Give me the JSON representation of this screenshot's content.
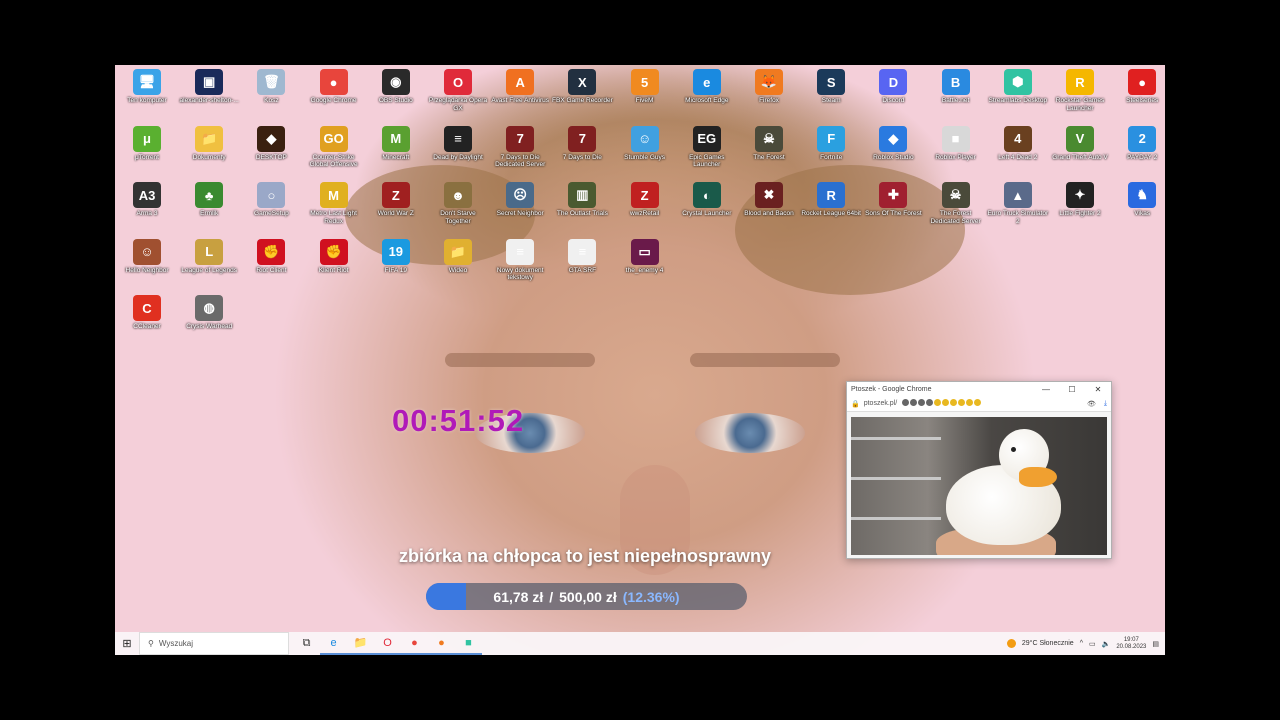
{
  "desktop": {
    "icons": [
      {
        "label": "Ten komputer",
        "glyph": "🖥",
        "color": "#3aa3e8"
      },
      {
        "label": "alexander-shelton-...",
        "glyph": "▣",
        "color": "#1a2a5a"
      },
      {
        "label": "Kosz",
        "glyph": "🗑",
        "color": "#9fb8d0"
      },
      {
        "label": "Google Chrome",
        "glyph": "●",
        "color": "#e8453c"
      },
      {
        "label": "OBS Studio",
        "glyph": "◉",
        "color": "#2a2a2a"
      },
      {
        "label": "Przeglądarka Opera GX",
        "glyph": "O",
        "color": "#e02a3a"
      },
      {
        "label": "Avast Free Antivirus",
        "glyph": "A",
        "color": "#f07020"
      },
      {
        "label": "FBX Game Recorder",
        "glyph": "X",
        "color": "#223040"
      },
      {
        "label": "FiveM",
        "glyph": "5",
        "color": "#f08a20"
      },
      {
        "label": "Microsoft Edge",
        "glyph": "e",
        "color": "#1a8ae0"
      },
      {
        "label": "Firefox",
        "glyph": "🦊",
        "color": "#f07a20"
      },
      {
        "label": "Steam",
        "glyph": "S",
        "color": "#1b3a5a"
      },
      {
        "label": "Discord",
        "glyph": "D",
        "color": "#5865f2"
      },
      {
        "label": "Battle.net",
        "glyph": "B",
        "color": "#2a8ae0"
      },
      {
        "label": "Streamlabs Desktop",
        "glyph": "⬢",
        "color": "#31c3a2"
      },
      {
        "label": "Rockstar Games Launcher",
        "glyph": "R",
        "color": "#f5b700"
      },
      {
        "label": "Steelseries",
        "glyph": "●",
        "color": "#e02020"
      },
      {
        "label": "μTorrent",
        "glyph": "μ",
        "color": "#5ab030"
      },
      {
        "label": "Dokumenty",
        "glyph": "📁",
        "color": "#f0c040"
      },
      {
        "label": "DESKTOP",
        "glyph": "◆",
        "color": "#3a2010"
      },
      {
        "label": "Counter-Strike Global Offensive",
        "glyph": "GO",
        "color": "#e0a020"
      },
      {
        "label": "Minecraft",
        "glyph": "M",
        "color": "#5aa030"
      },
      {
        "label": "Dead by Daylight",
        "glyph": "≡",
        "color": "#222"
      },
      {
        "label": "7 Days to Die Dedicated Server",
        "glyph": "7",
        "color": "#802020"
      },
      {
        "label": "7 Days to Die",
        "glyph": "7",
        "color": "#802020"
      },
      {
        "label": "Stumble Guys",
        "glyph": "☺",
        "color": "#40a0e0"
      },
      {
        "label": "Epic Games Launcher",
        "glyph": "EG",
        "color": "#222"
      },
      {
        "label": "The Forest",
        "glyph": "☠",
        "color": "#4a4a3a"
      },
      {
        "label": "Fortnite",
        "glyph": "F",
        "color": "#2aa0e0"
      },
      {
        "label": "Roblox Studio",
        "glyph": "◆",
        "color": "#2a7ae0"
      },
      {
        "label": "Roblox Player",
        "glyph": "■",
        "color": "#d8d8d8"
      },
      {
        "label": "Left 4 Dead 2",
        "glyph": "4",
        "color": "#6a4020"
      },
      {
        "label": "Grand Theft Auto V",
        "glyph": "V",
        "color": "#4a8a30"
      },
      {
        "label": "PAYDAY 2",
        "glyph": "2",
        "color": "#2a90e0"
      },
      {
        "label": "Arma 3",
        "glyph": "A3",
        "color": "#333"
      },
      {
        "label": "Ermlik",
        "glyph": "♣",
        "color": "#3a8a30"
      },
      {
        "label": "GameSetup",
        "glyph": "○",
        "color": "#9aa8c8"
      },
      {
        "label": "Metro Last Light Redux",
        "glyph": "M",
        "color": "#e0b020"
      },
      {
        "label": "World War Z",
        "glyph": "Z",
        "color": "#a02020"
      },
      {
        "label": "Don't Starve Together",
        "glyph": "☻",
        "color": "#8a7040"
      },
      {
        "label": "Secret Neighbor",
        "glyph": "☹",
        "color": "#4a6a8a"
      },
      {
        "label": "The Outlast Trials",
        "glyph": "▥",
        "color": "#4a5a30"
      },
      {
        "label": "wwzRetail",
        "glyph": "Z",
        "color": "#c02020"
      },
      {
        "label": "Crystal Launcher",
        "glyph": "◐",
        "color": "#1a5a4a"
      },
      {
        "label": "Blood and Bacon",
        "glyph": "✖",
        "color": "#6a2020"
      },
      {
        "label": "Rocket League 64bit",
        "glyph": "R",
        "color": "#2a70d0"
      },
      {
        "label": "Sons Of The Forest",
        "glyph": "✚",
        "color": "#a02030"
      },
      {
        "label": "The Forest Dedicated Server",
        "glyph": "☠",
        "color": "#4a4a3a"
      },
      {
        "label": "Euro Truck Simulator 2",
        "glyph": "▲",
        "color": "#5a6a8a"
      },
      {
        "label": "Little Fighter 2",
        "glyph": "✦",
        "color": "#222"
      },
      {
        "label": "Vikas",
        "glyph": "♞",
        "color": "#2a6ae0"
      },
      {
        "label": "Hello Neighbor",
        "glyph": "☺",
        "color": "#a05030"
      },
      {
        "label": "League of Legends",
        "glyph": "L",
        "color": "#c8a040"
      },
      {
        "label": "Riot Client",
        "glyph": "✊",
        "color": "#d01020"
      },
      {
        "label": "Klient Riot",
        "glyph": "✊",
        "color": "#d01020"
      },
      {
        "label": "FIFA 19",
        "glyph": "19",
        "color": "#1a9ae0"
      },
      {
        "label": "Wideo",
        "glyph": "📁",
        "color": "#e0b030"
      },
      {
        "label": "Nowy dokument tekstowy",
        "glyph": "≡",
        "color": "#f0f0f0"
      },
      {
        "label": "GTA SRF",
        "glyph": "≡",
        "color": "#f0f0f0"
      },
      {
        "label": "the_enemy 4",
        "glyph": "▭",
        "color": "#6a1a4a"
      },
      {
        "label": "CCleaner",
        "glyph": "C",
        "color": "#e03020"
      },
      {
        "label": "Crysis Warhead",
        "glyph": "◍",
        "color": "#6a6a6a"
      }
    ]
  },
  "overlay": {
    "timer": "00:51:52",
    "title": "zbiórka na chłopca to jest niepełnosprawny",
    "raised": "61,78 zł",
    "separator": "/",
    "goal": "500,00 zł",
    "percent_text": "(12.36%)",
    "percent": 12.36
  },
  "chrome_window": {
    "title": "Ptoszek - Google Chrome",
    "url": "ptoszek.pl/",
    "minimize": "—",
    "maximize": "☐",
    "close": "✕"
  },
  "taskbar": {
    "start_glyph": "⊞",
    "search_placeholder": "Wyszukaj",
    "search_glyph": "⚲",
    "weather": "29°C Słonecznie",
    "time": "19:07",
    "date": "20.08.2023",
    "apps": [
      {
        "name": "task-view",
        "glyph": "⧉",
        "color": "#333"
      },
      {
        "name": "edge",
        "glyph": "e",
        "color": "#1a8ae0"
      },
      {
        "name": "explorer",
        "glyph": "📁",
        "color": "#e0b030"
      },
      {
        "name": "opera",
        "glyph": "O",
        "color": "#e02a3a"
      },
      {
        "name": "chrome",
        "glyph": "●",
        "color": "#e8453c"
      },
      {
        "name": "firefox",
        "glyph": "●",
        "color": "#f07a20"
      },
      {
        "name": "streamlabs",
        "glyph": "■",
        "color": "#31c3a2"
      }
    ]
  }
}
